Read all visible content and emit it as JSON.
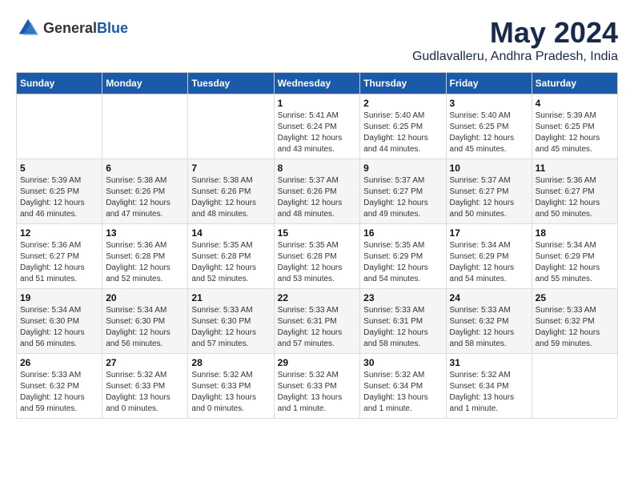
{
  "logo": {
    "text_general": "General",
    "text_blue": "Blue"
  },
  "title": "May 2024",
  "subtitle": "Gudlavalleru, Andhra Pradesh, India",
  "days_of_week": [
    "Sunday",
    "Monday",
    "Tuesday",
    "Wednesday",
    "Thursday",
    "Friday",
    "Saturday"
  ],
  "weeks": [
    [
      {
        "day": "",
        "info": ""
      },
      {
        "day": "",
        "info": ""
      },
      {
        "day": "",
        "info": ""
      },
      {
        "day": "1",
        "info": "Sunrise: 5:41 AM\nSunset: 6:24 PM\nDaylight: 12 hours\nand 43 minutes."
      },
      {
        "day": "2",
        "info": "Sunrise: 5:40 AM\nSunset: 6:25 PM\nDaylight: 12 hours\nand 44 minutes."
      },
      {
        "day": "3",
        "info": "Sunrise: 5:40 AM\nSunset: 6:25 PM\nDaylight: 12 hours\nand 45 minutes."
      },
      {
        "day": "4",
        "info": "Sunrise: 5:39 AM\nSunset: 6:25 PM\nDaylight: 12 hours\nand 45 minutes."
      }
    ],
    [
      {
        "day": "5",
        "info": "Sunrise: 5:39 AM\nSunset: 6:25 PM\nDaylight: 12 hours\nand 46 minutes."
      },
      {
        "day": "6",
        "info": "Sunrise: 5:38 AM\nSunset: 6:26 PM\nDaylight: 12 hours\nand 47 minutes."
      },
      {
        "day": "7",
        "info": "Sunrise: 5:38 AM\nSunset: 6:26 PM\nDaylight: 12 hours\nand 48 minutes."
      },
      {
        "day": "8",
        "info": "Sunrise: 5:37 AM\nSunset: 6:26 PM\nDaylight: 12 hours\nand 48 minutes."
      },
      {
        "day": "9",
        "info": "Sunrise: 5:37 AM\nSunset: 6:27 PM\nDaylight: 12 hours\nand 49 minutes."
      },
      {
        "day": "10",
        "info": "Sunrise: 5:37 AM\nSunset: 6:27 PM\nDaylight: 12 hours\nand 50 minutes."
      },
      {
        "day": "11",
        "info": "Sunrise: 5:36 AM\nSunset: 6:27 PM\nDaylight: 12 hours\nand 50 minutes."
      }
    ],
    [
      {
        "day": "12",
        "info": "Sunrise: 5:36 AM\nSunset: 6:27 PM\nDaylight: 12 hours\nand 51 minutes."
      },
      {
        "day": "13",
        "info": "Sunrise: 5:36 AM\nSunset: 6:28 PM\nDaylight: 12 hours\nand 52 minutes."
      },
      {
        "day": "14",
        "info": "Sunrise: 5:35 AM\nSunset: 6:28 PM\nDaylight: 12 hours\nand 52 minutes."
      },
      {
        "day": "15",
        "info": "Sunrise: 5:35 AM\nSunset: 6:28 PM\nDaylight: 12 hours\nand 53 minutes."
      },
      {
        "day": "16",
        "info": "Sunrise: 5:35 AM\nSunset: 6:29 PM\nDaylight: 12 hours\nand 54 minutes."
      },
      {
        "day": "17",
        "info": "Sunrise: 5:34 AM\nSunset: 6:29 PM\nDaylight: 12 hours\nand 54 minutes."
      },
      {
        "day": "18",
        "info": "Sunrise: 5:34 AM\nSunset: 6:29 PM\nDaylight: 12 hours\nand 55 minutes."
      }
    ],
    [
      {
        "day": "19",
        "info": "Sunrise: 5:34 AM\nSunset: 6:30 PM\nDaylight: 12 hours\nand 56 minutes."
      },
      {
        "day": "20",
        "info": "Sunrise: 5:34 AM\nSunset: 6:30 PM\nDaylight: 12 hours\nand 56 minutes."
      },
      {
        "day": "21",
        "info": "Sunrise: 5:33 AM\nSunset: 6:30 PM\nDaylight: 12 hours\nand 57 minutes."
      },
      {
        "day": "22",
        "info": "Sunrise: 5:33 AM\nSunset: 6:31 PM\nDaylight: 12 hours\nand 57 minutes."
      },
      {
        "day": "23",
        "info": "Sunrise: 5:33 AM\nSunset: 6:31 PM\nDaylight: 12 hours\nand 58 minutes."
      },
      {
        "day": "24",
        "info": "Sunrise: 5:33 AM\nSunset: 6:32 PM\nDaylight: 12 hours\nand 58 minutes."
      },
      {
        "day": "25",
        "info": "Sunrise: 5:33 AM\nSunset: 6:32 PM\nDaylight: 12 hours\nand 59 minutes."
      }
    ],
    [
      {
        "day": "26",
        "info": "Sunrise: 5:33 AM\nSunset: 6:32 PM\nDaylight: 12 hours\nand 59 minutes."
      },
      {
        "day": "27",
        "info": "Sunrise: 5:32 AM\nSunset: 6:33 PM\nDaylight: 13 hours\nand 0 minutes."
      },
      {
        "day": "28",
        "info": "Sunrise: 5:32 AM\nSunset: 6:33 PM\nDaylight: 13 hours\nand 0 minutes."
      },
      {
        "day": "29",
        "info": "Sunrise: 5:32 AM\nSunset: 6:33 PM\nDaylight: 13 hours\nand 1 minute."
      },
      {
        "day": "30",
        "info": "Sunrise: 5:32 AM\nSunset: 6:34 PM\nDaylight: 13 hours\nand 1 minute."
      },
      {
        "day": "31",
        "info": "Sunrise: 5:32 AM\nSunset: 6:34 PM\nDaylight: 13 hours\nand 1 minute."
      },
      {
        "day": "",
        "info": ""
      }
    ]
  ]
}
